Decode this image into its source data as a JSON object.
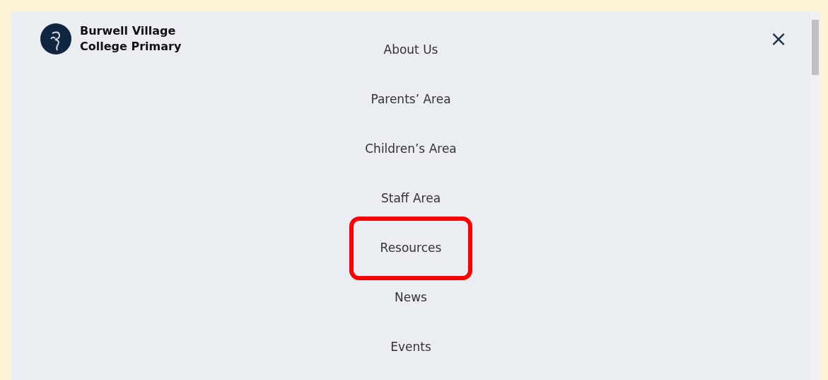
{
  "logo": {
    "name_lines": [
      "Burwell Village",
      "College Primary"
    ]
  },
  "close_button": {
    "glyph": "×"
  },
  "menu": [
    {
      "label": "About Us",
      "highlighted": false
    },
    {
      "label": "Parents’ Area",
      "highlighted": false
    },
    {
      "label": "Children’s Area",
      "highlighted": false
    },
    {
      "label": "Staff Area",
      "highlighted": false
    },
    {
      "label": "Resources",
      "highlighted": true
    },
    {
      "label": "News",
      "highlighted": false
    },
    {
      "label": "Events",
      "highlighted": false
    }
  ]
}
